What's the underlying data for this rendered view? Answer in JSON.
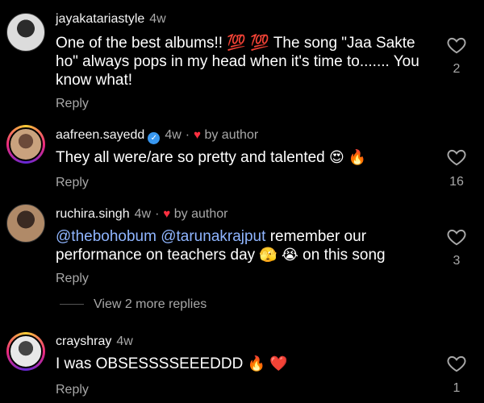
{
  "comments": [
    {
      "username": "jayakatariastyle",
      "time": "4w",
      "text": "One of the best albums!! 💯 💯  The song \"Jaa Sakte ho\" always pops in my head when it's time to....... You know what!",
      "reply_label": "Reply",
      "like_count": "2"
    },
    {
      "username": "aafreen.sayedd",
      "time": "4w",
      "verified_mark": "✓",
      "liked_by_author_heart": "♥",
      "by_author": "by author",
      "text": "They all were/are so pretty and talented ",
      "emojis": "😍 🔥",
      "reply_label": "Reply",
      "like_count": "16"
    },
    {
      "username": "ruchira.singh",
      "time": "4w",
      "liked_by_author_heart": "♥",
      "by_author": "by author",
      "mention1": "@thebohobum",
      "mention2": "@tarunakrajput",
      "text": " remember our performance on teachers day ",
      "emojis": "🫣 😭",
      "text_after": "  on this song",
      "reply_label": "Reply",
      "like_count": "3"
    },
    {
      "username": "crayshray",
      "time": "4w",
      "text": "I was OBSESSSSEEEDDD ",
      "emojis": "🔥 ❤️",
      "reply_label": "Reply",
      "like_count": "1"
    }
  ],
  "view_more_replies": "View 2 more replies",
  "icons": {
    "like": "heart-outline-icon",
    "liked_by_author": "heart-filled-icon",
    "verified": "verified-badge-icon"
  },
  "colors": {
    "background": "#000000",
    "text": "#ffffff",
    "secondary": "#a8a8a8",
    "mention": "#8fb5ff",
    "heart": "#ff3040",
    "verified": "#3897f0"
  }
}
